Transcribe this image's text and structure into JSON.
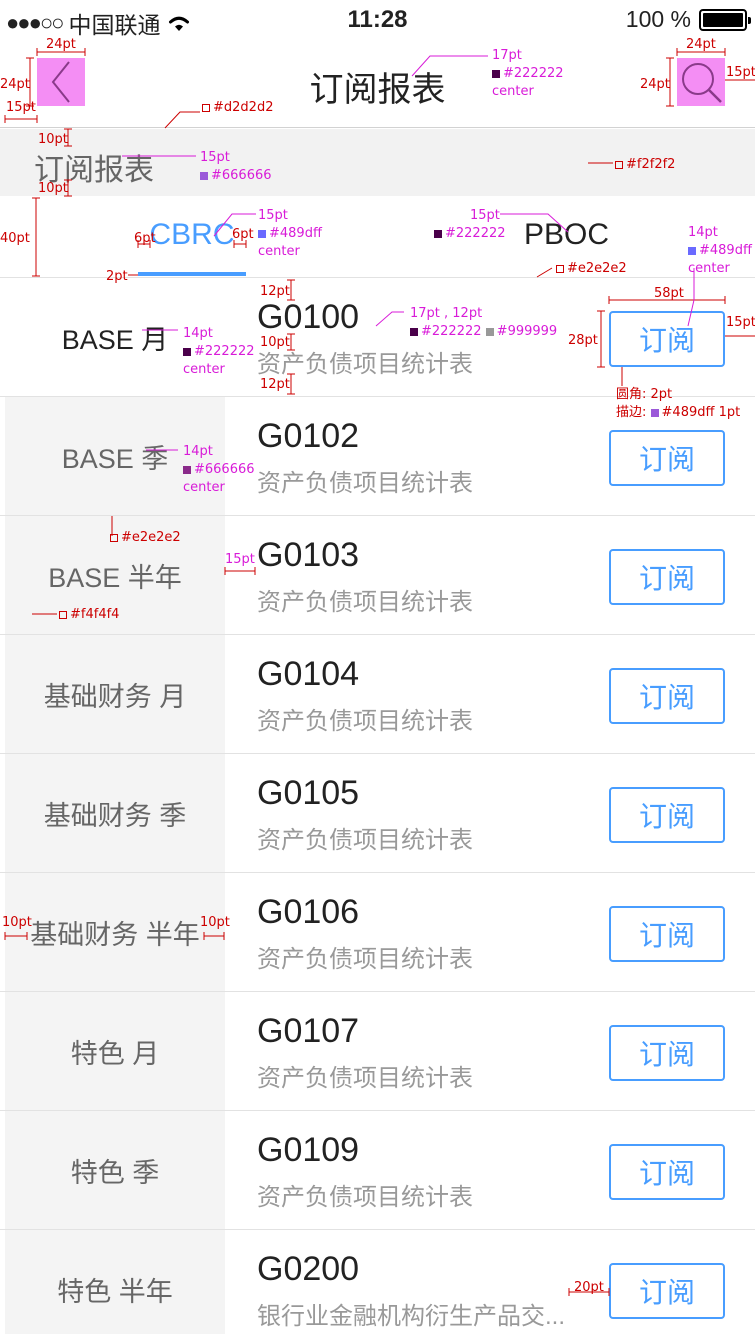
{
  "status_bar": {
    "signal": "●●●○○",
    "carrier": "中国联通",
    "time": "11:28",
    "battery": "100 %"
  },
  "nav": {
    "title": "订阅报表",
    "back_icon": "chevron-left-icon",
    "search_icon": "search-icon"
  },
  "section": {
    "title": "订阅报表"
  },
  "tabs": [
    {
      "label": "CBRC",
      "active": true,
      "color": "#489dff"
    },
    {
      "label": "PBOC",
      "active": false,
      "color": "#222222"
    }
  ],
  "rows": [
    {
      "category": "BASE 月",
      "code": "G0100",
      "desc": "资产负债项目统计表",
      "button": "订阅"
    },
    {
      "category": "BASE 季",
      "code": "G0102",
      "desc": "资产负债项目统计表",
      "button": "订阅"
    },
    {
      "category": "BASE 半年",
      "code": "G0103",
      "desc": "资产负债项目统计表",
      "button": "订阅"
    },
    {
      "category": "基础财务 月",
      "code": "G0104",
      "desc": "资产负债项目统计表",
      "button": "订阅"
    },
    {
      "category": "基础财务 季",
      "code": "G0105",
      "desc": "资产负债项目统计表",
      "button": "订阅"
    },
    {
      "category": "基础财务 半年",
      "code": "G0106",
      "desc": "资产负债项目统计表",
      "button": "订阅"
    },
    {
      "category": "特色 月",
      "code": "G0107",
      "desc": "资产负债项目统计表",
      "button": "订阅"
    },
    {
      "category": "特色 季",
      "code": "G0109",
      "desc": "资产负债项目统计表",
      "button": "订阅"
    },
    {
      "category": "特色 半年",
      "code": "G0200",
      "desc": "银行业金融机构衍生产品交...",
      "button": "订阅"
    }
  ],
  "annotations": {
    "back_w": "24pt",
    "back_h": "24pt",
    "back_left": "15pt",
    "title_spec": "17pt",
    "title_color": "#222222",
    "title_align": "center",
    "search_w": "24pt",
    "search_h": "24pt",
    "search_right": "15pt",
    "divider_color": "#d2d2d2",
    "section_pad_top": "10pt",
    "section_pad_bottom": "10pt",
    "section_font": "15pt",
    "section_color": "#666666",
    "section_bg": "#f2f2f2",
    "tabs_h": "40pt",
    "tab_pad_l": "6pt",
    "tab_pad_r": "6pt",
    "underline_h": "2pt",
    "cbrc_font": "15pt",
    "cbrc_color": "#489dff",
    "cbrc_align": "center",
    "pboc_font": "15pt",
    "pboc_color": "#222222",
    "tab_border": "#e2e2e2",
    "btn_font": "14pt",
    "btn_color": "#489dff",
    "btn_align": "center",
    "row_pad_top": "12pt",
    "row_gap": "10pt",
    "row_pad_bottom": "12pt",
    "code_spec": "17pt , 12pt",
    "code_color": "#222222",
    "desc_color": "#999999",
    "btn_w": "58pt",
    "btn_h": "28pt",
    "btn_right": "15pt",
    "btn_radius": "圆角: 2pt",
    "btn_stroke_label": "描边:",
    "btn_stroke": "#489dff  1pt",
    "cat1_font": "14pt",
    "cat1_color": "#222222",
    "cat1_align": "center",
    "cat2_font": "14pt",
    "cat2_color": "#666666",
    "cat2_align": "center",
    "row_border": "#e2e2e2",
    "code_left": "15pt",
    "left_bg": "#f4f4f4",
    "cat_pad_l": "10pt",
    "cat_pad_r": "10pt",
    "btn_gap": "20pt"
  }
}
